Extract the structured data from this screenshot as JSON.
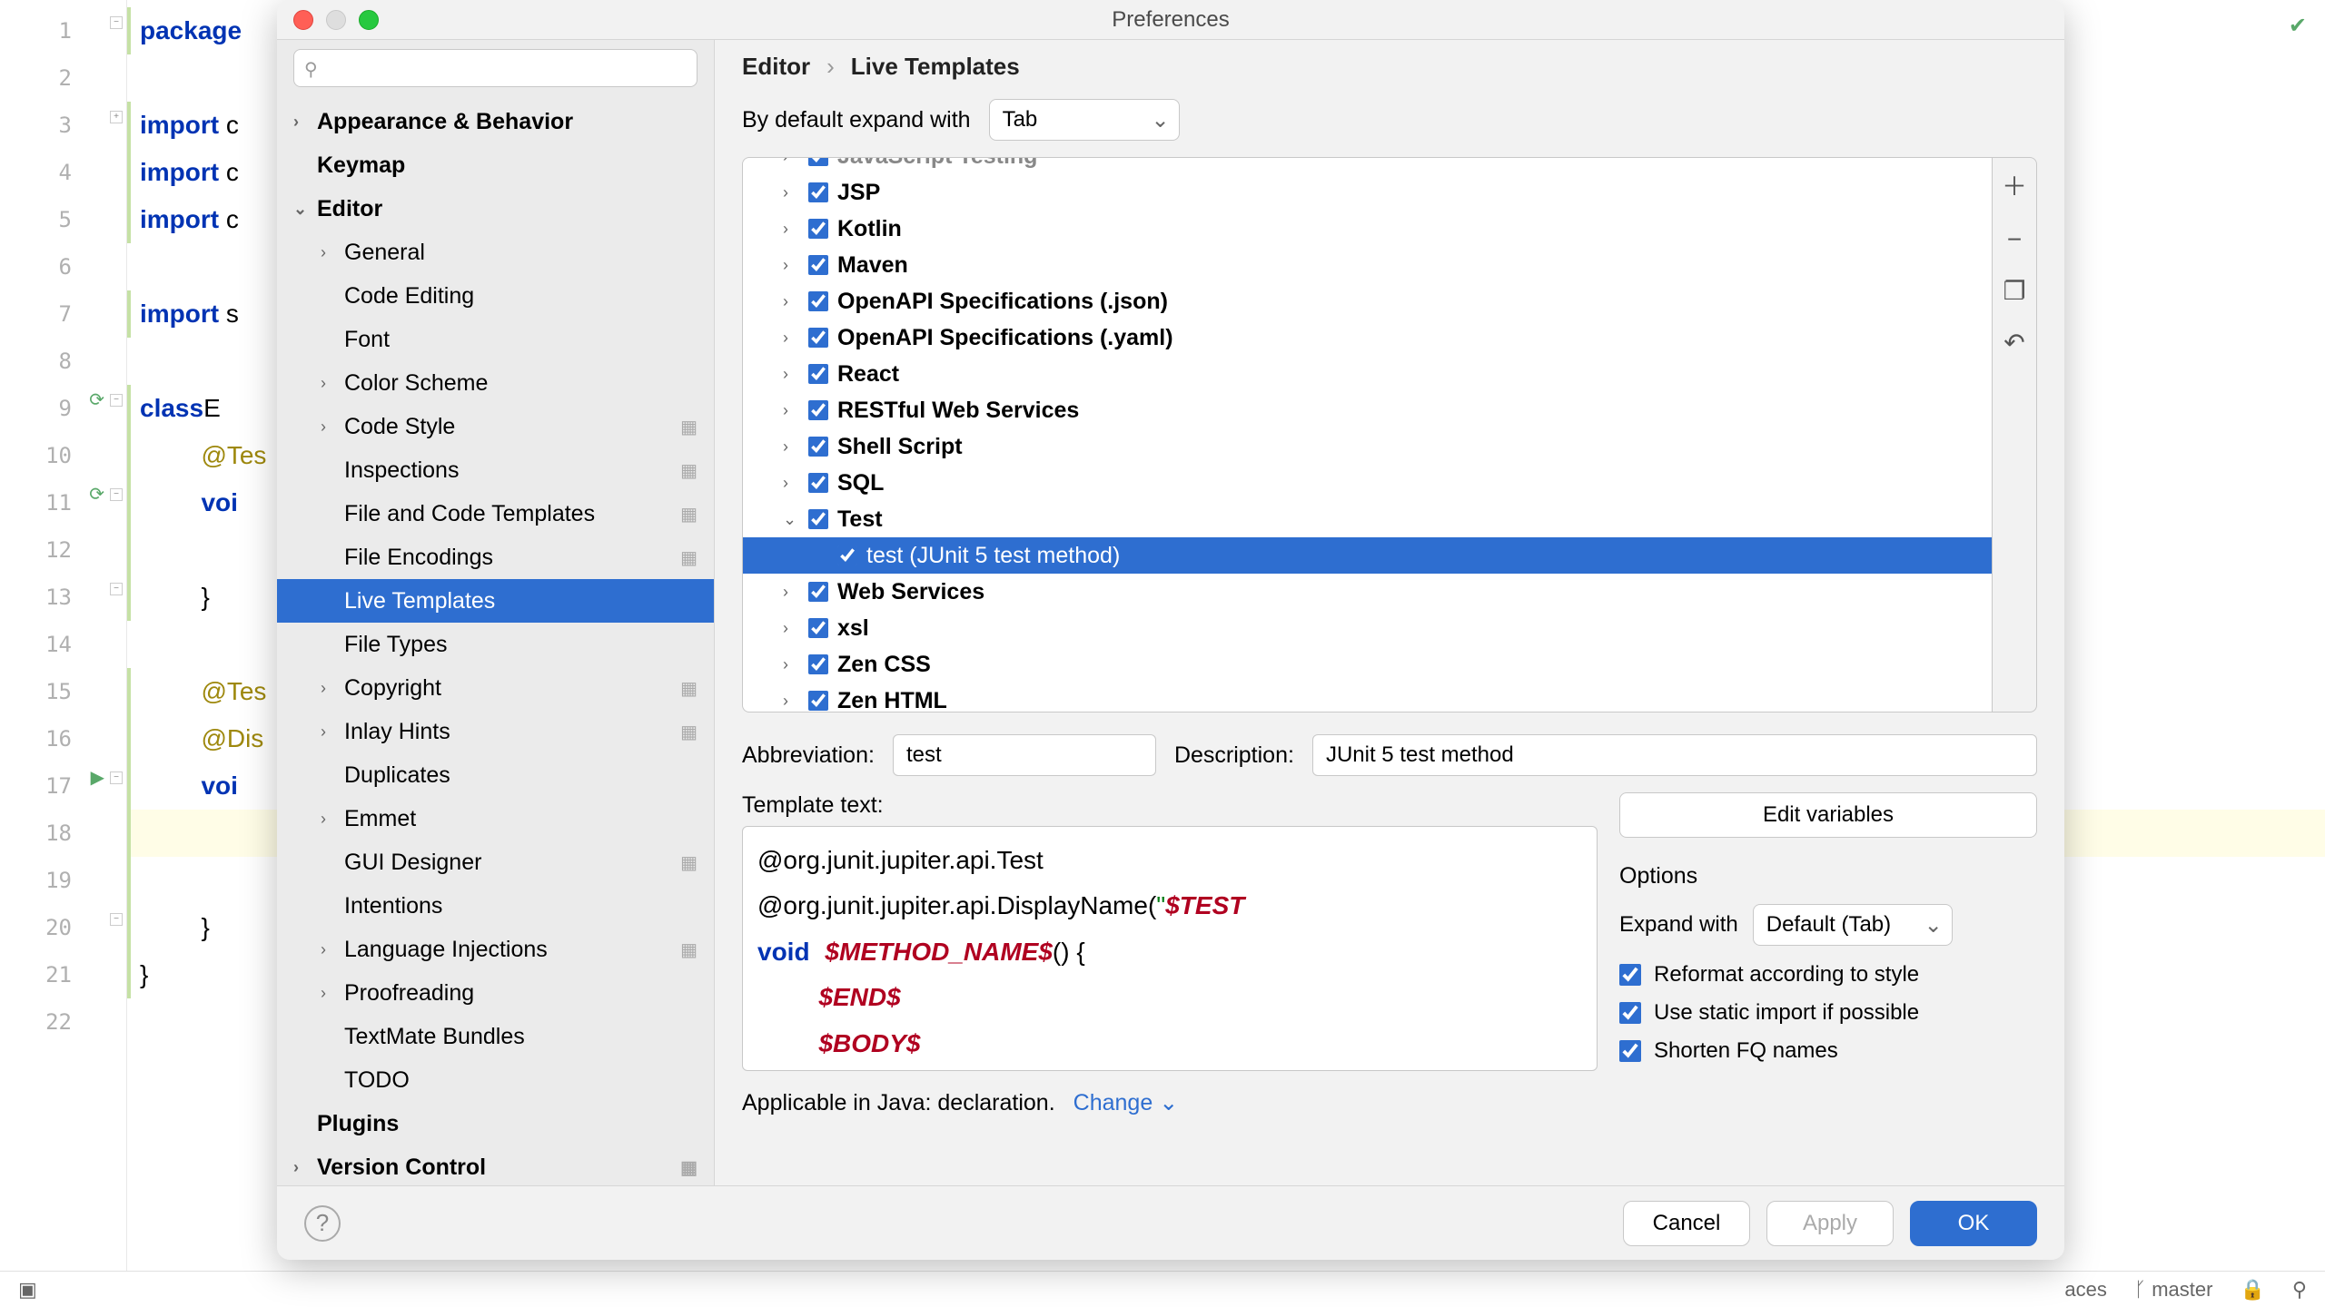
{
  "dialog": {
    "title": "Preferences",
    "breadcrumb": {
      "p1": "Editor",
      "p2": "Live Templates"
    }
  },
  "sidebar_tree": [
    {
      "label": "Appearance & Behavior",
      "bold": true,
      "chev": "closed",
      "lvl": 0
    },
    {
      "label": "Keymap",
      "bold": true,
      "chev": "none",
      "lvl": 0
    },
    {
      "label": "Editor",
      "bold": true,
      "chev": "open",
      "lvl": 0
    },
    {
      "label": "General",
      "chev": "closed",
      "lvl": 1
    },
    {
      "label": "Code Editing",
      "chev": "none",
      "lvl": 1
    },
    {
      "label": "Font",
      "chev": "none",
      "lvl": 1
    },
    {
      "label": "Color Scheme",
      "chev": "closed",
      "lvl": 1
    },
    {
      "label": "Code Style",
      "chev": "closed",
      "lvl": 1,
      "inst": true
    },
    {
      "label": "Inspections",
      "chev": "none",
      "lvl": 1,
      "inst": true
    },
    {
      "label": "File and Code Templates",
      "chev": "none",
      "lvl": 1,
      "inst": true
    },
    {
      "label": "File Encodings",
      "chev": "none",
      "lvl": 1,
      "inst": true
    },
    {
      "label": "Live Templates",
      "chev": "none",
      "lvl": 1,
      "sel": true
    },
    {
      "label": "File Types",
      "chev": "none",
      "lvl": 1
    },
    {
      "label": "Copyright",
      "chev": "closed",
      "lvl": 1,
      "inst": true
    },
    {
      "label": "Inlay Hints",
      "chev": "closed",
      "lvl": 1,
      "inst": true
    },
    {
      "label": "Duplicates",
      "chev": "none",
      "lvl": 1
    },
    {
      "label": "Emmet",
      "chev": "closed",
      "lvl": 1
    },
    {
      "label": "GUI Designer",
      "chev": "none",
      "lvl": 1,
      "inst": true
    },
    {
      "label": "Intentions",
      "chev": "none",
      "lvl": 1
    },
    {
      "label": "Language Injections",
      "chev": "closed",
      "lvl": 1,
      "inst": true
    },
    {
      "label": "Proofreading",
      "chev": "closed",
      "lvl": 1
    },
    {
      "label": "TextMate Bundles",
      "chev": "none",
      "lvl": 1
    },
    {
      "label": "TODO",
      "chev": "none",
      "lvl": 1
    },
    {
      "label": "Plugins",
      "bold": true,
      "chev": "none",
      "lvl": 0
    },
    {
      "label": "Version Control",
      "bold": true,
      "chev": "closed",
      "lvl": 0,
      "inst": true
    }
  ],
  "expand_default": {
    "label": "By default expand with",
    "value": "Tab"
  },
  "template_groups": [
    {
      "label": "JavaScript Testing",
      "chev": "closed",
      "checked": true,
      "bold": true,
      "faded": true
    },
    {
      "label": "JSP",
      "chev": "closed",
      "checked": true,
      "bold": true
    },
    {
      "label": "Kotlin",
      "chev": "closed",
      "checked": true,
      "bold": true
    },
    {
      "label": "Maven",
      "chev": "closed",
      "checked": true,
      "bold": true
    },
    {
      "label": "OpenAPI Specifications (.json)",
      "chev": "closed",
      "checked": true,
      "bold": true
    },
    {
      "label": "OpenAPI Specifications (.yaml)",
      "chev": "closed",
      "checked": true,
      "bold": true
    },
    {
      "label": "React",
      "chev": "closed",
      "checked": true,
      "bold": true
    },
    {
      "label": "RESTful Web Services",
      "chev": "closed",
      "checked": true,
      "bold": true
    },
    {
      "label": "Shell Script",
      "chev": "closed",
      "checked": true,
      "bold": true
    },
    {
      "label": "SQL",
      "chev": "closed",
      "checked": true,
      "bold": true
    },
    {
      "label": "Test",
      "chev": "open",
      "checked": true,
      "bold": true
    },
    {
      "label": "test (JUnit 5 test method)",
      "chev": "none",
      "checked": true,
      "bold": false,
      "lvl": 2,
      "sel": true
    },
    {
      "label": "Web Services",
      "chev": "closed",
      "checked": true,
      "bold": true
    },
    {
      "label": "xsl",
      "chev": "closed",
      "checked": true,
      "bold": true
    },
    {
      "label": "Zen CSS",
      "chev": "closed",
      "checked": true,
      "bold": true
    },
    {
      "label": "Zen HTML",
      "chev": "closed",
      "checked": true,
      "bold": true
    }
  ],
  "abbr": {
    "label": "Abbreviation:",
    "value": "test"
  },
  "desc": {
    "label": "Description:",
    "value": "JUnit 5 test method"
  },
  "template_text": {
    "label": "Template text:",
    "l1": "@org.junit.jupiter.api.Test",
    "l2a": "@org.junit.jupiter.api.DisplayName(",
    "l2b": "\"",
    "l2c": "$TEST",
    "l3a": "void",
    "l3b": "$METHOD_NAME$",
    "l3c": "() {",
    "l4": "$END$",
    "l5": "$BODY$"
  },
  "edit_vars": "Edit variables",
  "options": {
    "title": "Options",
    "expand_with": {
      "label": "Expand with",
      "value": "Default (Tab)"
    },
    "o1": "Reformat according to style",
    "o2": "Use static import if possible",
    "o3": "Shorten FQ names"
  },
  "applicable": {
    "text": "Applicable in Java: declaration.",
    "change": "Change"
  },
  "footer": {
    "cancel": "Cancel",
    "apply": "Apply",
    "ok": "OK"
  },
  "status": {
    "spaces": "aces",
    "branch": "master"
  },
  "bg_code": {
    "l1": "package",
    "l3": "import",
    "l4": "import",
    "l5": "import",
    "l7": "import s",
    "l9a": "class",
    "l9b": " E",
    "l10": "@Tes",
    "l11": "voi",
    "l13": "}",
    "l15": "@Tes",
    "l16": "@Dis",
    "l17": "voi",
    "l20": "}",
    "l21": "}"
  }
}
